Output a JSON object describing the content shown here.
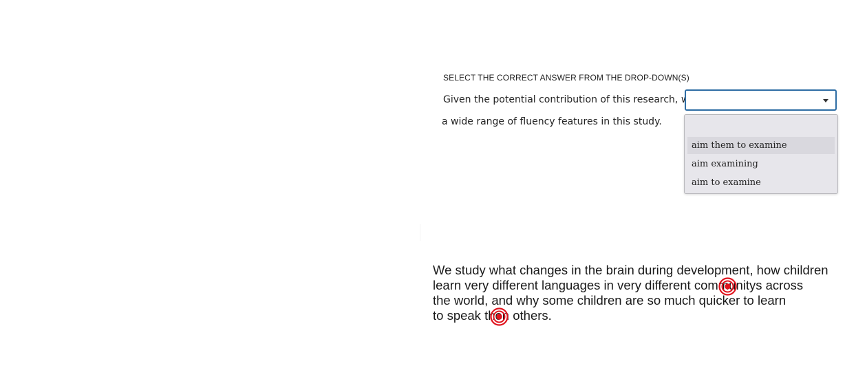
{
  "question": {
    "instruction": "SELECT THE CORRECT ANSWER FROM THE DROP-DOWN(S)",
    "sentence_before_blank": "Given the potential contribution of this research, we",
    "sentence_after_blank": "a wide range of fluency features in this study.",
    "dropdown": {
      "selected_value": "",
      "expanded": true,
      "options": [
        "",
        "aim them to examine",
        "aim examining",
        "aim to examine"
      ],
      "highlighted_option_index": 1,
      "border_color": "#2e6da4"
    }
  },
  "passage": {
    "lines": [
      "We study what changes in the brain during development, how children",
      "learn very different languages in very different communitys across",
      "the world, and why some children are so much quicker to learn",
      "to speak then others."
    ]
  },
  "error_markers": {
    "color": "#e0141e",
    "icon": "red-circle-target-icon",
    "count": 2
  }
}
